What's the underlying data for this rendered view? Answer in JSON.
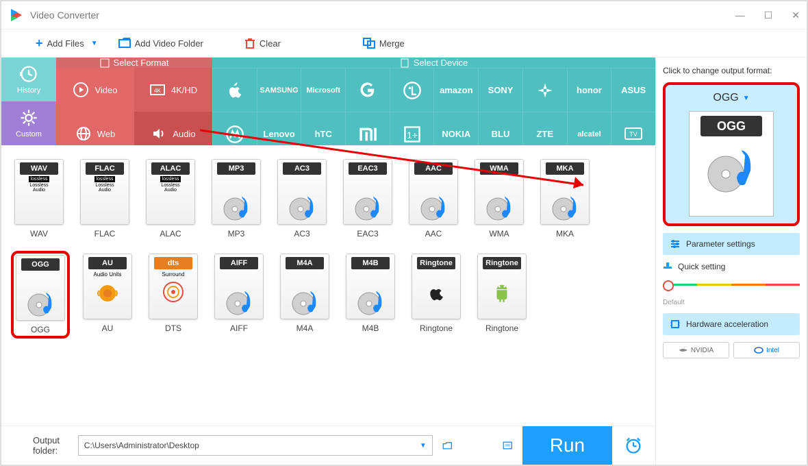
{
  "window": {
    "title": "Video Converter"
  },
  "toolbar": {
    "add_files": "Add Files",
    "add_folder": "Add Video Folder",
    "clear": "Clear",
    "merge": "Merge"
  },
  "side": {
    "history": "History",
    "custom": "Custom"
  },
  "headers": {
    "format": "Select Format",
    "device": "Select Device"
  },
  "format_tabs": {
    "video": "Video",
    "hd4k": "4K/HD",
    "web": "Web",
    "audio": "Audio"
  },
  "devices": {
    "row1": [
      "Apple",
      "SAMSUNG",
      "Microsoft",
      "G",
      "LG",
      "amazon",
      "SONY",
      "HUAWEI",
      "honor",
      "ASUS"
    ],
    "row2": [
      "Motorola",
      "Lenovo",
      "hTC",
      "MI",
      "OnePlus",
      "NOKIA",
      "BLU",
      "ZTE",
      "alcatel",
      "TV"
    ]
  },
  "formats": [
    {
      "label": "WAV",
      "badge": "WAV",
      "lossless": true
    },
    {
      "label": "FLAC",
      "badge": "FLAC",
      "lossless": true
    },
    {
      "label": "ALAC",
      "badge": "ALAC",
      "lossless": true
    },
    {
      "label": "MP3",
      "badge": "MP3"
    },
    {
      "label": "AC3",
      "badge": "AC3"
    },
    {
      "label": "EAC3",
      "badge": "EAC3"
    },
    {
      "label": "AAC",
      "badge": "AAC"
    },
    {
      "label": "WMA",
      "badge": "WMA"
    },
    {
      "label": "MKA",
      "badge": "MKA"
    },
    {
      "label": "OGG",
      "badge": "OGG",
      "selected": true
    },
    {
      "label": "AU",
      "badge": "AU",
      "sub": "Audio Units"
    },
    {
      "label": "DTS",
      "badge": "dts",
      "sub": "Surround",
      "orange": true
    },
    {
      "label": "AIFF",
      "badge": "AIFF"
    },
    {
      "label": "M4A",
      "badge": "M4A"
    },
    {
      "label": "M4B",
      "badge": "M4B"
    },
    {
      "label": "Ringtone",
      "badge": "Ringtone",
      "icon": "apple"
    },
    {
      "label": "Ringtone",
      "badge": "Ringtone",
      "icon": "android"
    }
  ],
  "right": {
    "hint": "Click to change output format:",
    "selected": "OGG",
    "param": "Parameter settings",
    "quick": "Quick setting",
    "slider_label": "Default",
    "hw": "Hardware acceleration",
    "nvidia": "NVIDIA",
    "intel": "Intel"
  },
  "bottom": {
    "label": "Output folder:",
    "path": "C:\\Users\\Administrator\\Desktop",
    "run": "Run"
  }
}
